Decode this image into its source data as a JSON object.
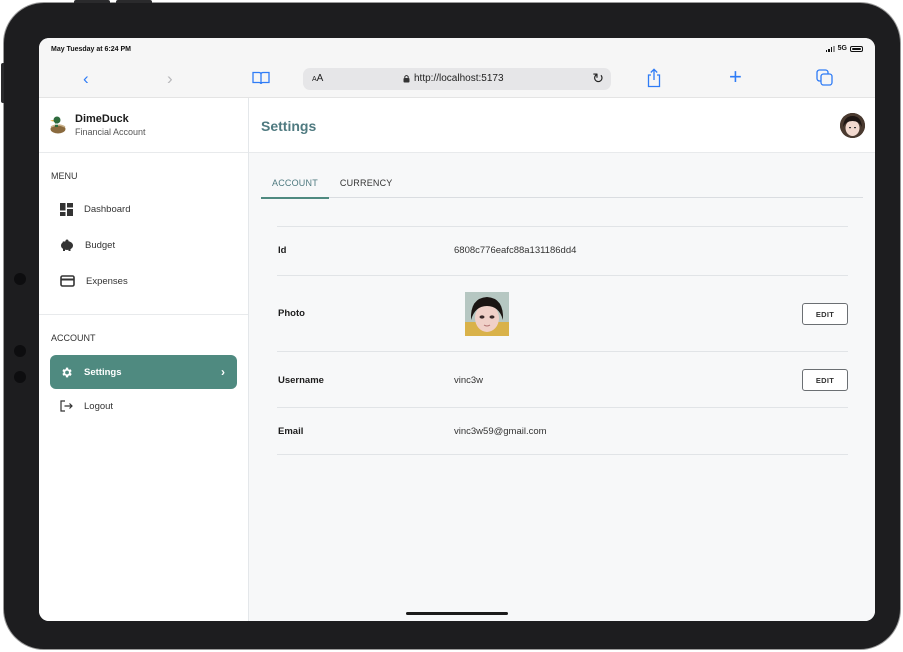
{
  "status": {
    "time": "May Tuesday at 6:24 PM",
    "network": "5G"
  },
  "browser": {
    "text_size": "AA",
    "url": "http://localhost:5173"
  },
  "brand": {
    "name": "DimeDuck",
    "subtitle": "Financial Account"
  },
  "sidebar": {
    "menu_label": "MENU",
    "menu_items": [
      {
        "label": "Dashboard",
        "icon": "dashboard-icon"
      },
      {
        "label": "Budget",
        "icon": "piggy-bank-icon"
      },
      {
        "label": "Expenses",
        "icon": "card-icon"
      }
    ],
    "account_label": "ACCOUNT",
    "account_items": [
      {
        "label": "Settings",
        "icon": "gear-icon",
        "active": true
      },
      {
        "label": "Logout",
        "icon": "logout-icon"
      }
    ]
  },
  "header": {
    "title": "Settings"
  },
  "tabs": [
    {
      "label": "ACCOUNT",
      "active": true
    },
    {
      "label": "CURRENCY",
      "active": false
    }
  ],
  "account": {
    "id_label": "Id",
    "id_value": "6808c776eafc88a131186dd4",
    "photo_label": "Photo",
    "username_label": "Username",
    "username_value": "vinc3w",
    "email_label": "Email",
    "email_value": "vinc3w59@gmail.com",
    "edit_label": "EDIT"
  },
  "colors": {
    "accent": "#4f8a80",
    "title": "#4f7a80",
    "ios_blue": "#2f7cf6"
  }
}
